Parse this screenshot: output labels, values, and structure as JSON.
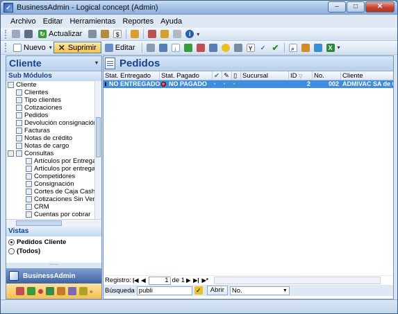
{
  "window": {
    "title": "BusinessAdmin - Logical concept (Admin)"
  },
  "menu": {
    "items": [
      "Archivo",
      "Editar",
      "Herramientas",
      "Reportes",
      "Ayuda"
    ]
  },
  "toolbar1": {
    "actualizar_label": "Actualizar"
  },
  "toolbar2": {
    "nuevo_label": "Nuevo",
    "suprimir_label": "Suprimir",
    "editar_label": "Editar"
  },
  "left": {
    "title": "Cliente",
    "submodulos_label": "Sub Módulos",
    "tree": [
      "Cliente",
      "Clientes",
      "Tipo clientes",
      "Cotizaciones",
      "Pedidos",
      "Devolución consignación",
      "Facturas",
      "Notas de crédito",
      "Notas de cargo",
      "Consultas",
      "Artículos por Entregar",
      "Artículos por entregar",
      "Competidores",
      "Consignación",
      "Cortes de Caja CashPoi",
      "Cotizaciones Sin Venta",
      "CRM",
      "Cuentas por cobrar"
    ],
    "vistas_label": "Vistas",
    "vistas": [
      "Pedidos Cliente",
      "(Todos)"
    ],
    "footer_title": "BusinessAdmin"
  },
  "right": {
    "title": "Pedidos",
    "columns": [
      "Stat. Entregado",
      "Stat. Pagado",
      "",
      "",
      "",
      "Sucursal",
      "ID",
      "No.",
      "Cliente"
    ],
    "rows": [
      {
        "entregado": "NO ENTREGADO",
        "pagado": "NO PAGADO",
        "id": "2",
        "no": "002",
        "cliente": "ADMIVAC SA de CV"
      }
    ],
    "nav": {
      "registro_label": "Registro:",
      "current": "1",
      "de_label": "de 1"
    },
    "search": {
      "label": "Búsqueda",
      "value": "publi",
      "abrir_label": "Abrir",
      "select_value": "No."
    }
  },
  "colors": {
    "accent": "#15428b",
    "selection": "#3e8de1"
  }
}
